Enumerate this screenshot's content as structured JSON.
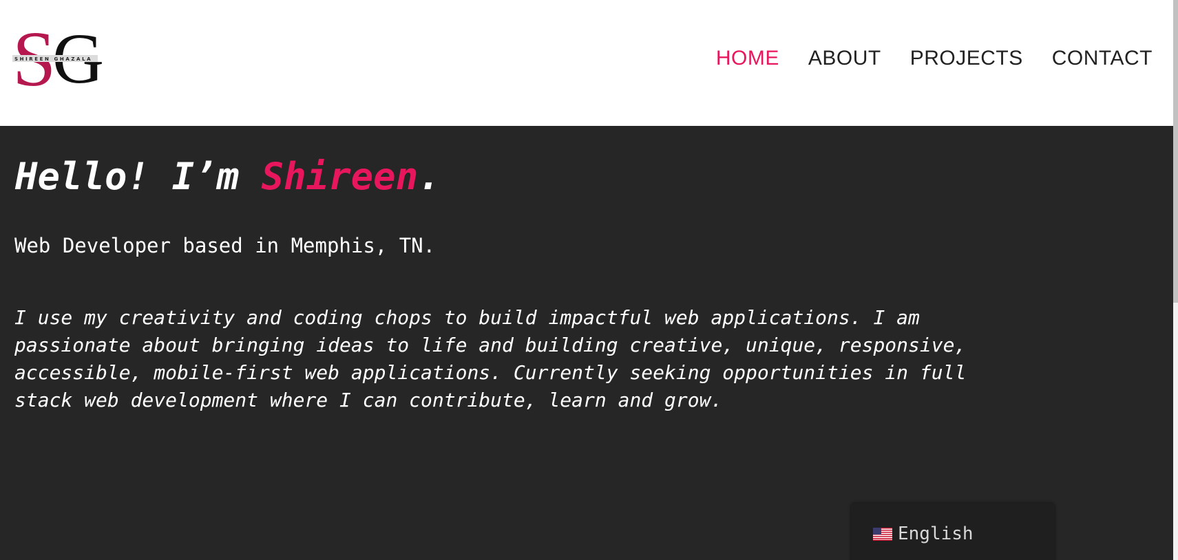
{
  "logo": {
    "letters": "SG",
    "wordmark": "SHIREEN GHAZALA",
    "icon": "sg-monogram-logo"
  },
  "nav": {
    "items": [
      {
        "label": "HOME",
        "active": true
      },
      {
        "label": "ABOUT",
        "active": false
      },
      {
        "label": "PROJECTS",
        "active": false
      },
      {
        "label": "CONTACT",
        "active": false
      }
    ]
  },
  "hero": {
    "greeting": "Hello! I’m ",
    "name": "Shireen",
    "period": ".",
    "subtitle": "Web Developer based in Memphis, TN.",
    "bio_lines": [
      "I use my creativity and coding chops to build impactful web applications. I am",
      "passionate about bringing ideas to life and building creative, unique, responsive,",
      "accessible, mobile-first web applications. Currently seeking opportunities in full",
      "stack web development where I can contribute, learn and grow."
    ]
  },
  "language": {
    "label": "English",
    "icon": "us-flag-icon"
  },
  "colors": {
    "accent": "#e8175d",
    "hero_bg": "#262626",
    "header_bg": "#ffffff",
    "nav_text": "#222222"
  }
}
